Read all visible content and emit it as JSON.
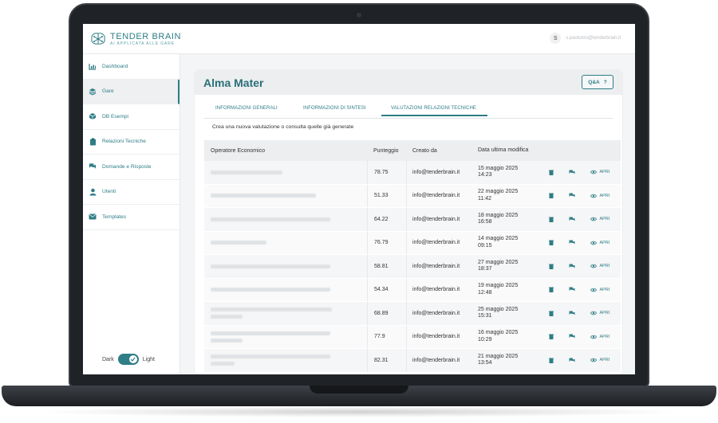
{
  "brand": {
    "name": "TENDER BRAIN",
    "tagline": "AI APPLICATA ALLE GARE",
    "accent": "#2f7d86"
  },
  "topbar": {
    "avatar_initial": "S",
    "email": "s.paolomo@tenderbrain.it"
  },
  "sidebar": {
    "items": [
      {
        "label": "Dashboard",
        "icon": "chart-icon"
      },
      {
        "label": "Gare",
        "icon": "layers-icon",
        "active": true
      },
      {
        "label": "DB Esempi",
        "icon": "cube-icon"
      },
      {
        "label": "Relazioni Tecniche",
        "icon": "clipboard-icon"
      },
      {
        "label": "Domande e Risposte",
        "icon": "chat-icon"
      },
      {
        "label": "Utenti",
        "icon": "user-icon"
      },
      {
        "label": "Templates",
        "icon": "mail-icon"
      }
    ],
    "theme": {
      "dark_label": "Dark",
      "light_label": "Light",
      "selected": "light"
    }
  },
  "main": {
    "title": "Alma Mater",
    "qa_label": "Q&A",
    "tabs": [
      {
        "label": "INFORMAZIONI GENERALI"
      },
      {
        "label": "INFORMAZIONI DI SINTESI"
      },
      {
        "label": "VALUTAZIONI RELAZIONI TECNICHE",
        "active": true
      }
    ],
    "subtitle": "Crea una nuova valutazione o consulta quelle già generate",
    "table": {
      "headers": [
        "Operatore Economico",
        "Punteggio",
        "Creato da",
        "Data ultima modifica"
      ],
      "open_label": "APRI",
      "rows": [
        {
          "score": "78.75",
          "creator": "info@tenderbrain.it",
          "date": "15 maggio 2025",
          "time": "14:23"
        },
        {
          "score": "51.33",
          "creator": "info@tenderbrain.it",
          "date": "22 maggio 2025",
          "time": "11:42"
        },
        {
          "score": "64.22",
          "creator": "info@tenderbrain.it",
          "date": "18 maggio 2025",
          "time": "16:58"
        },
        {
          "score": "76.79",
          "creator": "info@tenderbrain.it",
          "date": "14 maggio 2025",
          "time": "09:15"
        },
        {
          "score": "58.81",
          "creator": "info@tenderbrain.it",
          "date": "27 maggio 2025",
          "time": "18:37"
        },
        {
          "score": "54.34",
          "creator": "info@tenderbrain.it",
          "date": "19 maggio 2025",
          "time": "12:48"
        },
        {
          "score": "68.89",
          "creator": "info@tenderbrain.it",
          "date": "25 maggio 2025",
          "time": "15:31"
        },
        {
          "score": "77.9",
          "creator": "info@tenderbrain.it",
          "date": "16 maggio 2025",
          "time": "10:29"
        },
        {
          "score": "82.31",
          "creator": "info@tenderbrain.it",
          "date": "21 maggio 2025",
          "time": "13:54"
        }
      ]
    }
  }
}
